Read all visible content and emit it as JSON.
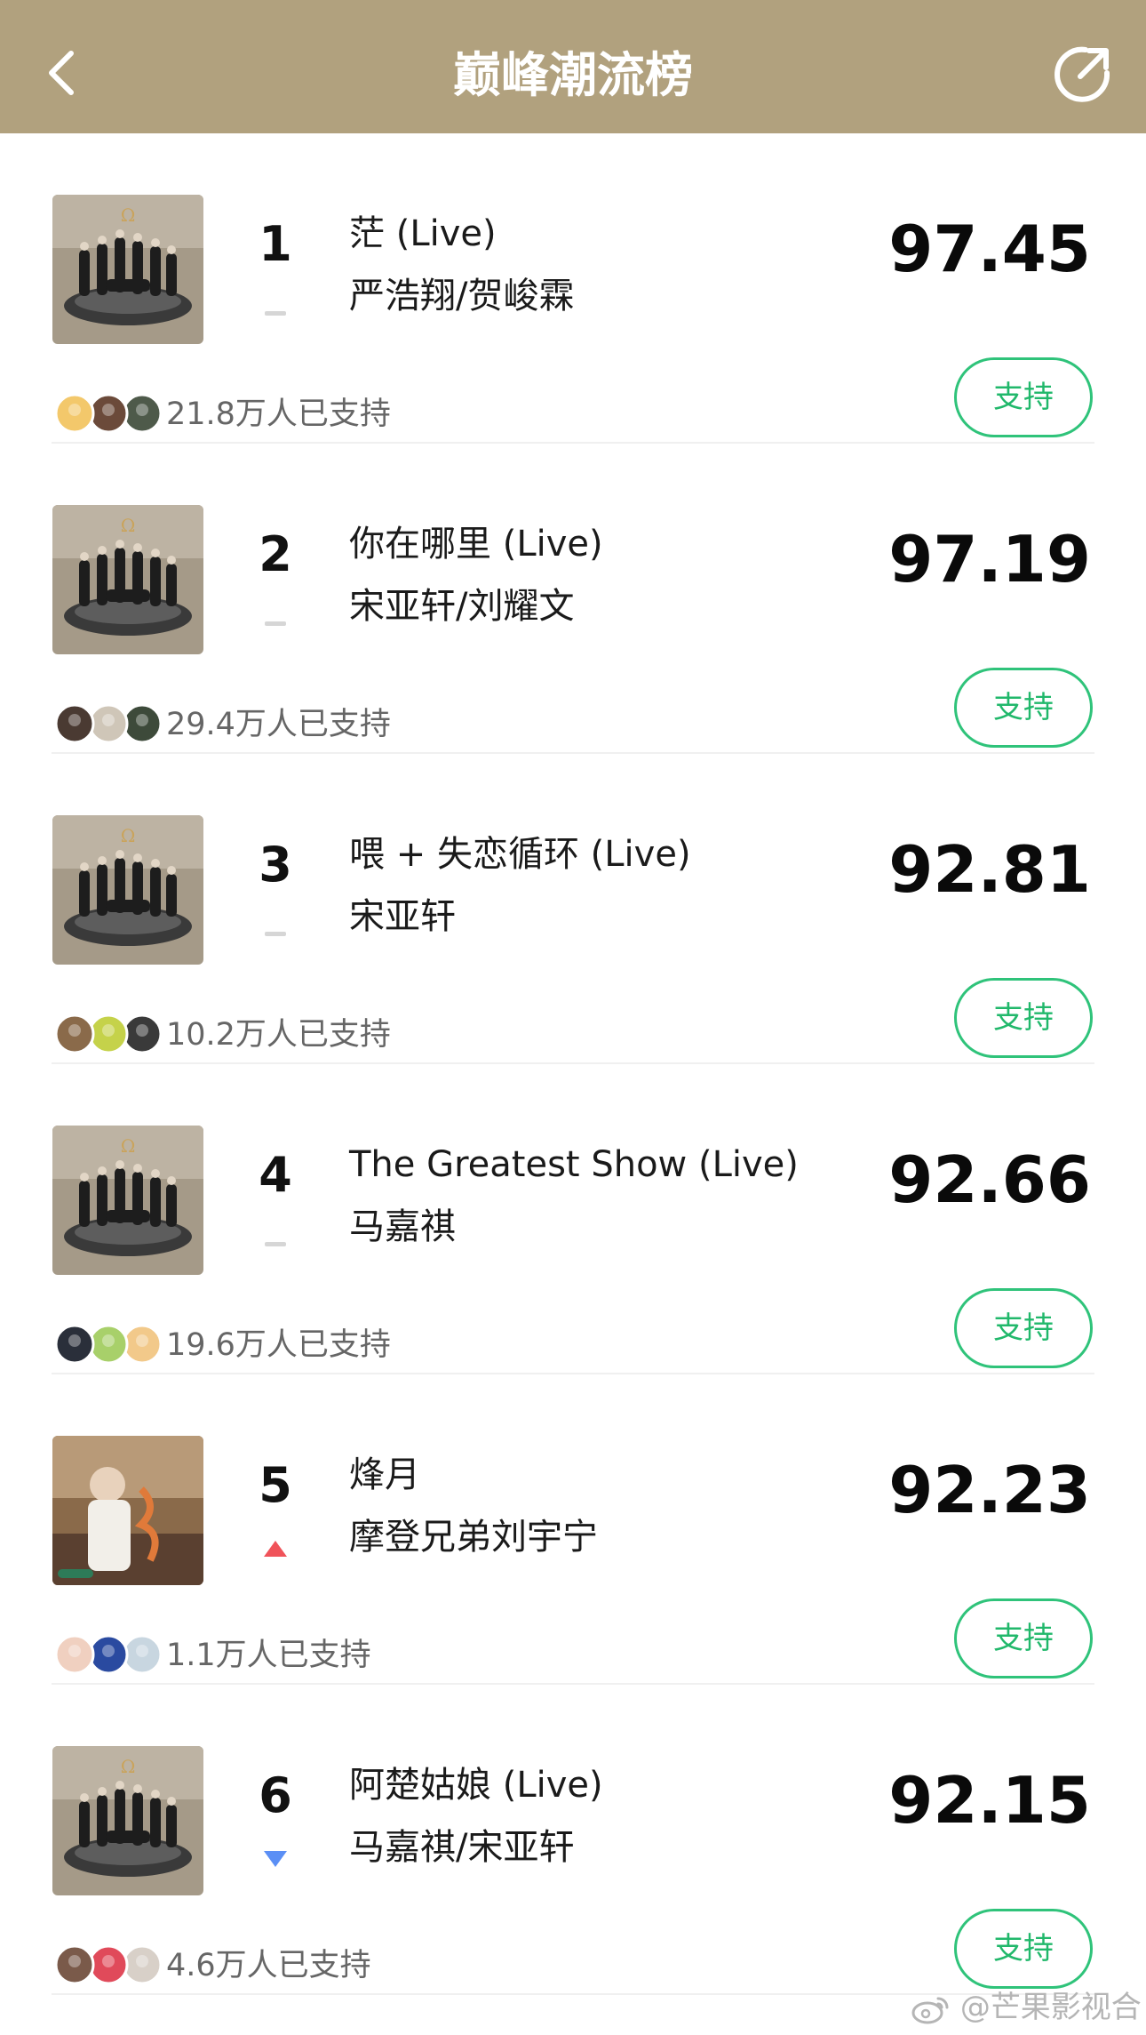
{
  "header": {
    "title": "巅峰潮流榜",
    "back_icon": "chevron-left-icon",
    "share_icon": "share-icon",
    "bg_color": "#b1a17e"
  },
  "rows": [
    {
      "rank": "1",
      "title": "茫 (Live)",
      "artist": "严浩翔/贺峻霖",
      "score": "97.45",
      "supporters": "21.8万人已支持",
      "trend": "flat",
      "button": "支持"
    },
    {
      "rank": "2",
      "title": "你在哪里 (Live)",
      "artist": "宋亚轩/刘耀文",
      "score": "97.19",
      "supporters": "29.4万人已支持",
      "trend": "flat",
      "button": "支持"
    },
    {
      "rank": "3",
      "title": "喂 + 失恋循环 (Live)",
      "artist": "宋亚轩",
      "score": "92.81",
      "supporters": "10.2万人已支持",
      "trend": "flat",
      "button": "支持"
    },
    {
      "rank": "4",
      "title": "The Greatest Show (Live)",
      "artist": "马嘉祺",
      "score": "92.66",
      "supporters": "19.6万人已支持",
      "trend": "flat",
      "button": "支持"
    },
    {
      "rank": "5",
      "title": "烽月",
      "artist": "摩登兄弟刘宇宁",
      "score": "92.23",
      "supporters": "1.1万人已支持",
      "trend": "up",
      "button": "支持"
    },
    {
      "rank": "6",
      "title": "阿楚姑娘 (Live)",
      "artist": "马嘉祺/宋亚轩",
      "score": "92.15",
      "supporters": "4.6万人已支持",
      "trend": "down",
      "button": "支持"
    }
  ],
  "colors": {
    "accent_green": "#21b86b",
    "trend_up": "#f0535a",
    "trend_down": "#5b8ff5",
    "trend_flat": "#d6d6d6"
  },
  "watermark": {
    "icon": "weibo-icon",
    "text": "@芒果影视合"
  }
}
